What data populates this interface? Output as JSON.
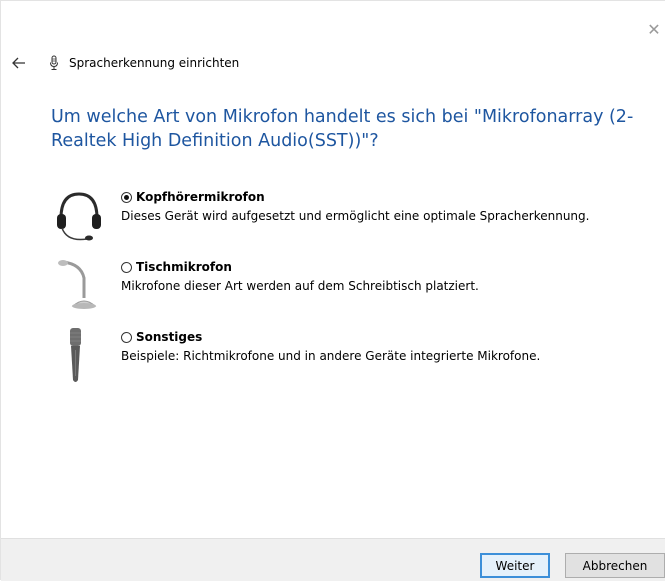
{
  "window": {
    "title": "Spracherkennung einrichten",
    "close_glyph": "✕"
  },
  "question": "Um welche Art von Mikrofon handelt es sich bei \"Mikrofonarray (2- Realtek High Definition Audio(SST))\"?",
  "options": [
    {
      "label": "Kopfhörermikrofon",
      "description": "Dieses Gerät wird aufgesetzt und ermöglicht eine optimale Spracherkennung.",
      "selected": true,
      "icon": "headset-microphone-icon"
    },
    {
      "label": "Tischmikrofon",
      "description": "Mikrofone dieser Art werden auf dem Schreibtisch platziert.",
      "selected": false,
      "icon": "desk-microphone-icon"
    },
    {
      "label": "Sonstiges",
      "description": "Beispiele: Richtmikrofone und in andere Geräte integrierte Mikrofone.",
      "selected": false,
      "icon": "handheld-microphone-icon"
    }
  ],
  "buttons": {
    "next": "Weiter",
    "cancel": "Abbrechen"
  },
  "colors": {
    "question_text": "#1e56a0",
    "footer_background": "#f0f0f0",
    "primary_button_border": "#3c8fd9"
  }
}
